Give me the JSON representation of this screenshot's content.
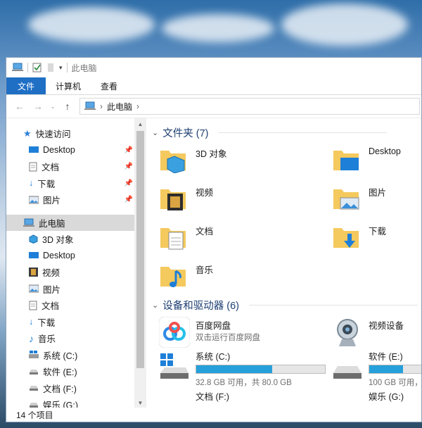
{
  "window": {
    "title": "此电脑",
    "ribbon_tabs": [
      "文件",
      "计算机",
      "查看"
    ],
    "address_path": "此电脑"
  },
  "sidebar": {
    "quick_access": "快速访问",
    "quick_items": [
      "Desktop",
      "文档",
      "下载",
      "图片"
    ],
    "this_pc": "此电脑",
    "pc_items": [
      "3D 对象",
      "Desktop",
      "视频",
      "图片",
      "文档",
      "下载",
      "音乐",
      "系统 (C:)",
      "软件 (E:)",
      "文档 (F:)",
      "娱乐 (G:)"
    ]
  },
  "folders_group": {
    "header": "文件夹 (7)",
    "items": [
      "3D 对象",
      "Desktop",
      "视频",
      "图片",
      "文档",
      "下载",
      "音乐"
    ]
  },
  "devices_group": {
    "header": "设备和驱动器 (6)",
    "baidu": {
      "name": "百度网盘",
      "sub": "双击运行百度网盘"
    },
    "camera": {
      "name": "视频设备"
    },
    "drive_c": {
      "name": "系统 (C:)",
      "sub": "32.8 GB 可用，共 80.0 GB",
      "used_fraction": 0.59
    },
    "drive_e": {
      "name": "软件 (E:)",
      "sub": "100 GB 可用，共 1",
      "used_fraction": 0.35
    },
    "drive_f": {
      "name": "文档 (F:)"
    },
    "drive_g": {
      "name": "娱乐 (G:)"
    }
  },
  "status": {
    "item_count": "14 个项目"
  },
  "colors": {
    "accent": "#1f6fc5",
    "folder": "#f4c95d",
    "drive_bar": "#26a0da",
    "group_header": "#1e3f73"
  }
}
